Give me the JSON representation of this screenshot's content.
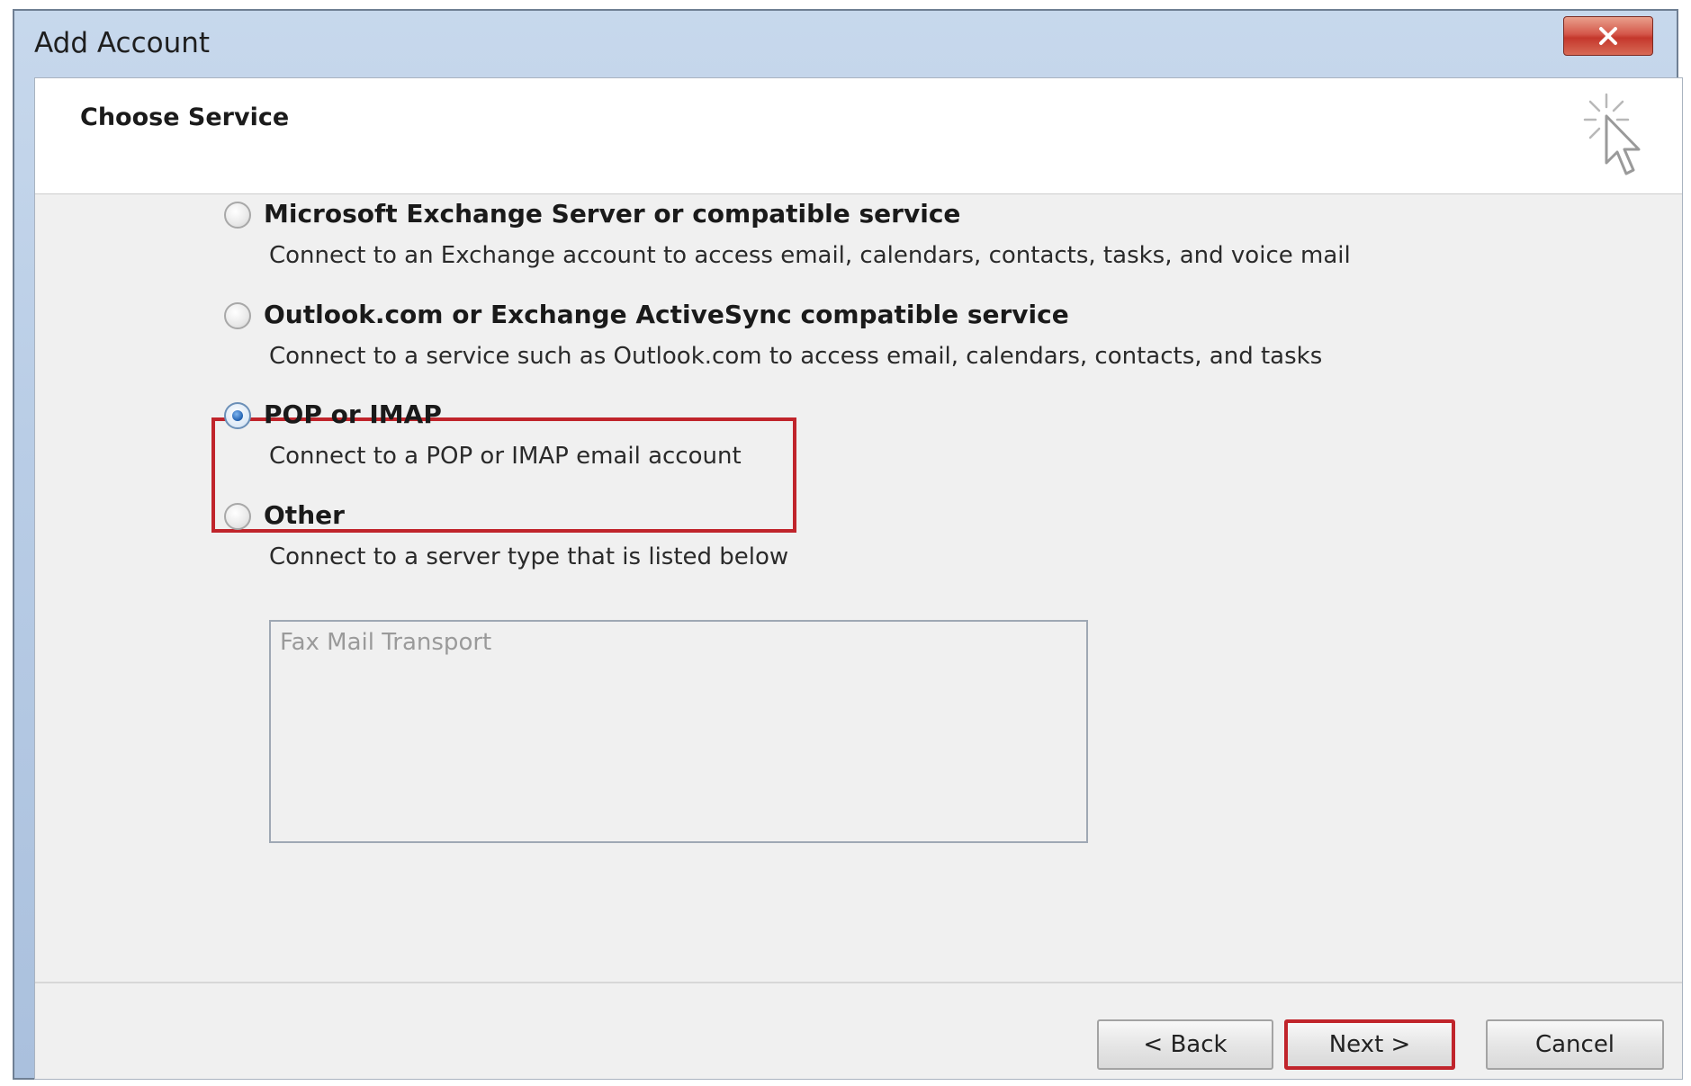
{
  "window": {
    "title": "Add Account",
    "close_label": "X"
  },
  "header": {
    "title": "Choose Service"
  },
  "options": [
    {
      "label": "Microsoft Exchange Server or compatible service",
      "description": "Connect to an Exchange account to access email, calendars, contacts, tasks, and voice mail",
      "selected": false
    },
    {
      "label": "Outlook.com or Exchange ActiveSync compatible service",
      "description": "Connect to a service such as Outlook.com to access email, calendars, contacts, and tasks",
      "selected": false
    },
    {
      "label": "POP or IMAP",
      "description": "Connect to a POP or IMAP email account",
      "selected": true
    },
    {
      "label": "Other",
      "description": "Connect to a server type that is listed below",
      "selected": false
    }
  ],
  "other_list": {
    "items": [
      "Fax Mail Transport"
    ]
  },
  "buttons": {
    "back": "< Back",
    "next": "Next >",
    "cancel": "Cancel"
  },
  "colors": {
    "highlight": "#c0242b",
    "titlebar": "#b9cde6",
    "client_bg": "#f0f0f0"
  }
}
